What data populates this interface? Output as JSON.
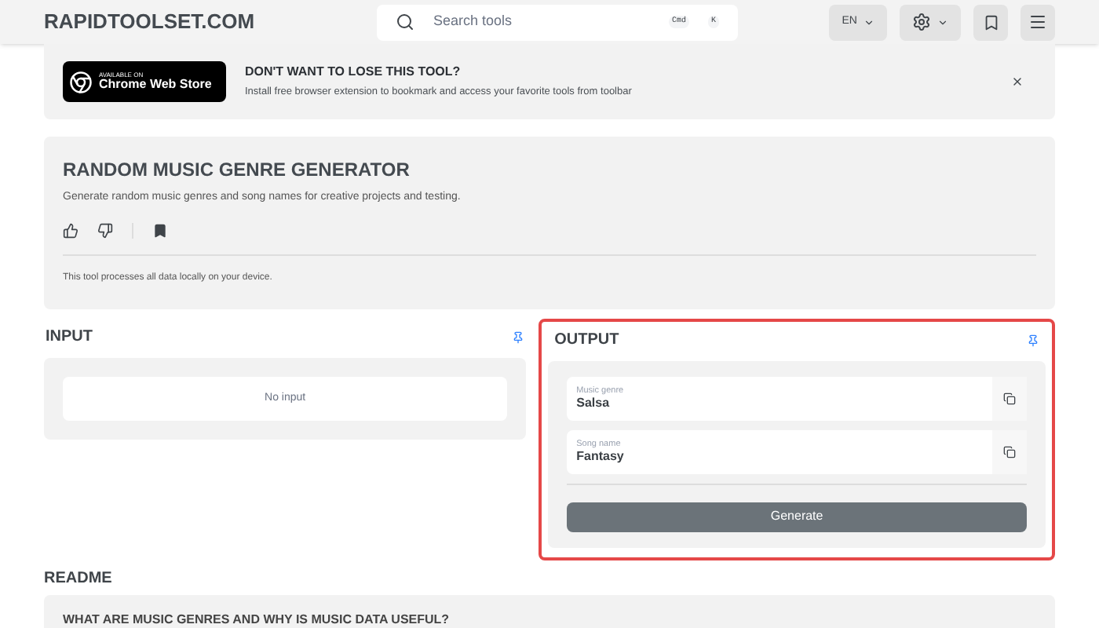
{
  "header": {
    "logo": "RAPIDTOOLSET.COM",
    "search": {
      "placeholder": "Search tools",
      "shortcut_keys": [
        "Cmd",
        "K"
      ]
    },
    "language": "EN"
  },
  "banner": {
    "store_badge": {
      "small": "AVAILABLE ON",
      "large": "Chrome Web Store"
    },
    "title": "DON'T WANT TO LOSE THIS TOOL?",
    "text": "Install free browser extension to bookmark and access your favorite tools from toolbar"
  },
  "tool": {
    "title": "RANDOM MUSIC GENRE GENERATOR",
    "description": "Generate random music genres and song names for creative projects and testing.",
    "privacy_note": "This tool processes all data locally on your device."
  },
  "input": {
    "heading": "INPUT",
    "empty_text": "No input"
  },
  "output": {
    "heading": "OUTPUT",
    "highlighted": true,
    "fields": [
      {
        "label": "Music genre",
        "value": "Salsa"
      },
      {
        "label": "Song name",
        "value": "Fantasy"
      }
    ],
    "button": "Generate"
  },
  "readme": {
    "heading": "README",
    "question": "WHAT ARE MUSIC GENRES AND WHY IS MUSIC DATA USEFUL?"
  }
}
